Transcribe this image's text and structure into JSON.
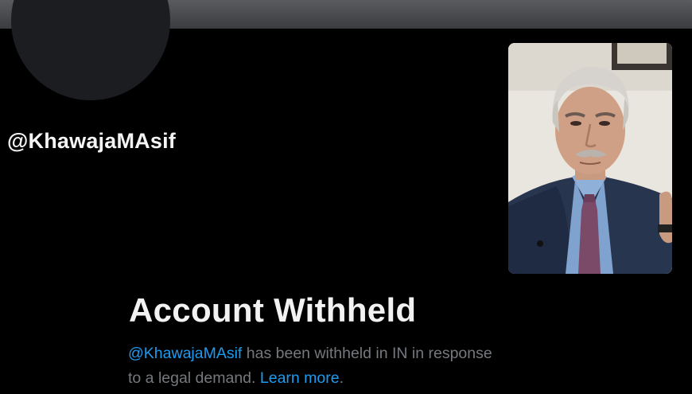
{
  "profile": {
    "handle": "@KhawajaMAsif"
  },
  "withheld_notice": {
    "title": "Account Withheld",
    "mention": "@KhawajaMAsif",
    "body_line1": " has been withheld in IN in response",
    "body_line2": "to a legal demand. ",
    "learn_more": "Learn more",
    "trailing": "."
  },
  "colors": {
    "background": "#000000",
    "link": "#1d9bf0",
    "muted_text": "#75797e",
    "banner": "#4a4b4e"
  },
  "icons": {
    "avatar": "avatar-placeholder",
    "inset_photo": "person-portrait"
  }
}
